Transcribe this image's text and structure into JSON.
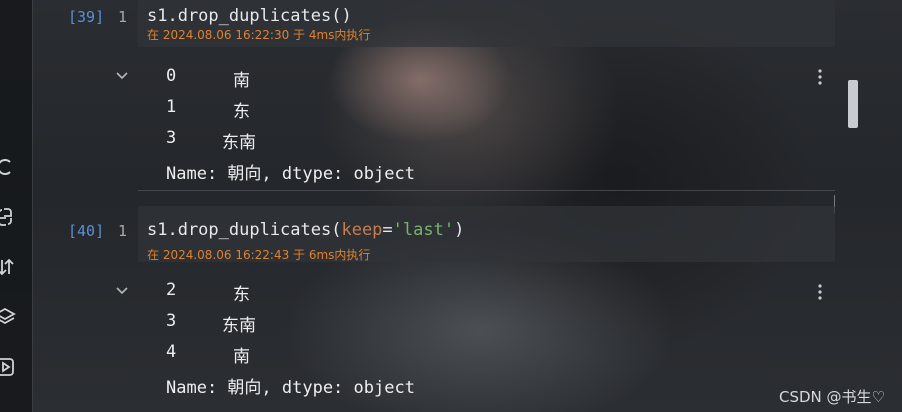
{
  "cells": [
    {
      "prompt": "[39]",
      "line_number": "1",
      "code": "s1.drop_duplicates()",
      "exec_meta": "在 2024.08.06 16:22:30 于 4ms内执行",
      "output": {
        "rows": [
          {
            "index": "0",
            "value": "南"
          },
          {
            "index": "1",
            "value": "东"
          },
          {
            "index": "3",
            "value": "东南"
          }
        ],
        "footer": "Name: 朝向, dtype: object"
      }
    },
    {
      "prompt": "[40]",
      "line_number": "1",
      "code_prefix": "s1.drop_duplicates(",
      "code_kw": "keep",
      "code_eq": "=",
      "code_str": "'last'",
      "code_suffix": ")",
      "exec_meta": "在 2024.08.06 16:22:43 于 6ms内执行",
      "output": {
        "rows": [
          {
            "index": "2",
            "value": "东"
          },
          {
            "index": "3",
            "value": "东南"
          },
          {
            "index": "4",
            "value": "南"
          }
        ],
        "footer": "Name: 朝向, dtype: object"
      }
    }
  ],
  "left_strip_icons": [
    "refresh-icon",
    "python-icon",
    "sort-icon",
    "layers-icon",
    "play-icon"
  ],
  "watermark": "CSDN @书生♡",
  "colors": {
    "prompt": "#5a8fd6",
    "exec_meta": "#e0822d",
    "keyword": "#c77d4d",
    "string": "#78b36f"
  }
}
